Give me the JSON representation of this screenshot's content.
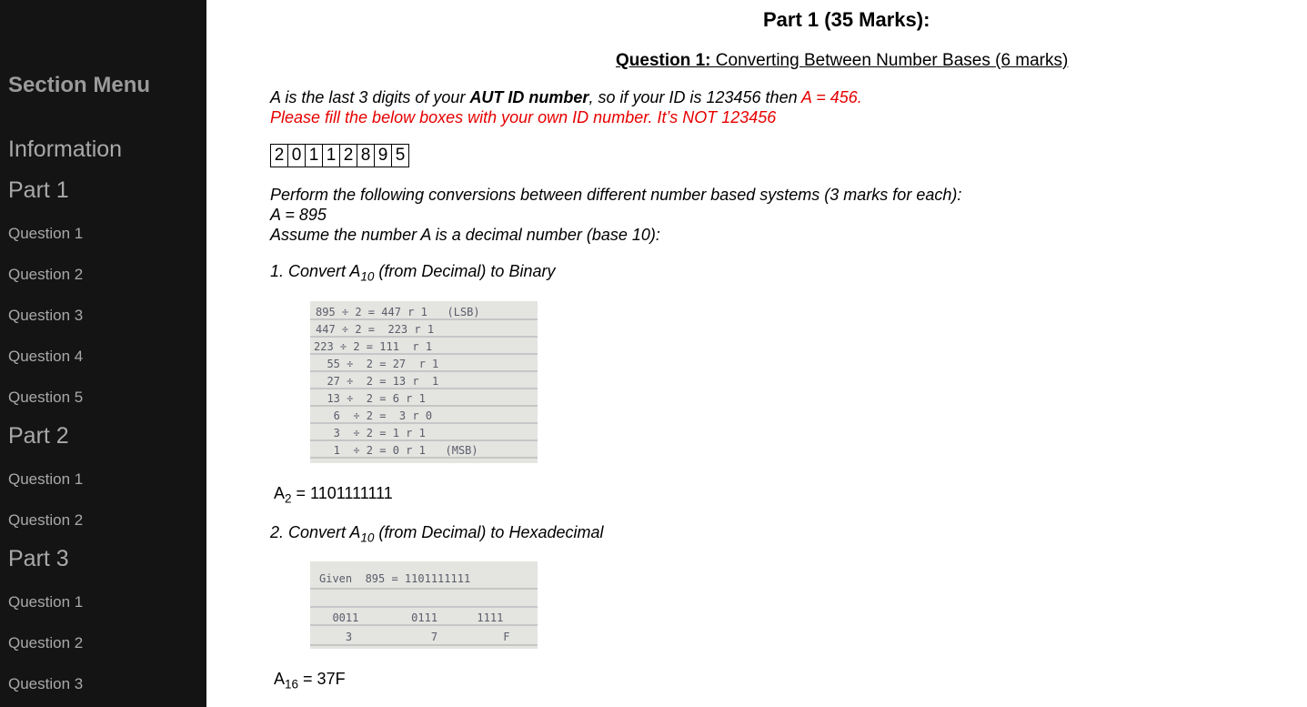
{
  "sidebar": {
    "title": "Section Menu",
    "items": [
      {
        "label": "Information",
        "size": "big"
      },
      {
        "label": "Part 1",
        "size": "big"
      },
      {
        "label": "Question 1",
        "size": "small"
      },
      {
        "label": "Question 2",
        "size": "small"
      },
      {
        "label": "Question 3",
        "size": "small"
      },
      {
        "label": "Question 4",
        "size": "small"
      },
      {
        "label": "Question 5",
        "size": "small"
      },
      {
        "label": "Part 2",
        "size": "big"
      },
      {
        "label": "Question 1",
        "size": "small"
      },
      {
        "label": "Question 2",
        "size": "small"
      },
      {
        "label": "Part 3",
        "size": "big"
      },
      {
        "label": "Question 1",
        "size": "small"
      },
      {
        "label": "Question 2",
        "size": "small"
      },
      {
        "label": "Question 3",
        "size": "small"
      }
    ]
  },
  "main": {
    "part_title": "Part 1 (35 Marks):",
    "question_label": "Question 1:",
    "question_title": " Converting Between Number Bases (6 marks)",
    "intro": {
      "p1": "A is the last 3 digits of your ",
      "bold": "AUT ID number",
      "p2": ", so if your ID is 123456 then ",
      "red_a": "A = 456.",
      "red_line": "Please fill the below boxes with your own ID number. It’s NOT 123456"
    },
    "id_digits": [
      "2",
      "0",
      "1",
      "1",
      "2",
      "8",
      "9",
      "5"
    ],
    "perform_line": "Perform the following conversions between different number based systems (3 marks for each):",
    "a_value_line": "A = 895",
    "assume_line": "Assume the number A is a decimal number (base 10):",
    "q1": {
      "prefix": "1. Convert A",
      "sub": "10",
      "suffix": " (from Decimal) to Binary"
    },
    "answer1": {
      "label": "A",
      "sub": "2",
      "value": " = 1101111111"
    },
    "q2": {
      "prefix": "2. Convert A",
      "sub": "10",
      "suffix": " (from Decimal) to Hexadecimal"
    },
    "answer2": {
      "label": "A",
      "sub": "16",
      "value": " = 37F"
    }
  },
  "work_binary": [
    "895 ÷ 2 = 447 r 1   (LSB)",
    "447 ÷ 2 =  223 r 1",
    "223 ÷ 2 = 111  r 1",
    "  55 ÷  2 = 27  r 1",
    "  27 ÷  2 = 13 r  1",
    "  13 ÷  2 = 6 r 1",
    "   6  ÷ 2 =  3 r 0",
    "   3  ÷ 2 = 1 r 1",
    "   1  ÷ 2 = 0 r 1   (MSB)"
  ],
  "work_hex": [
    "Given  895 = 1101111111",
    "  0011        0111      1111",
    "    3            7          F"
  ]
}
